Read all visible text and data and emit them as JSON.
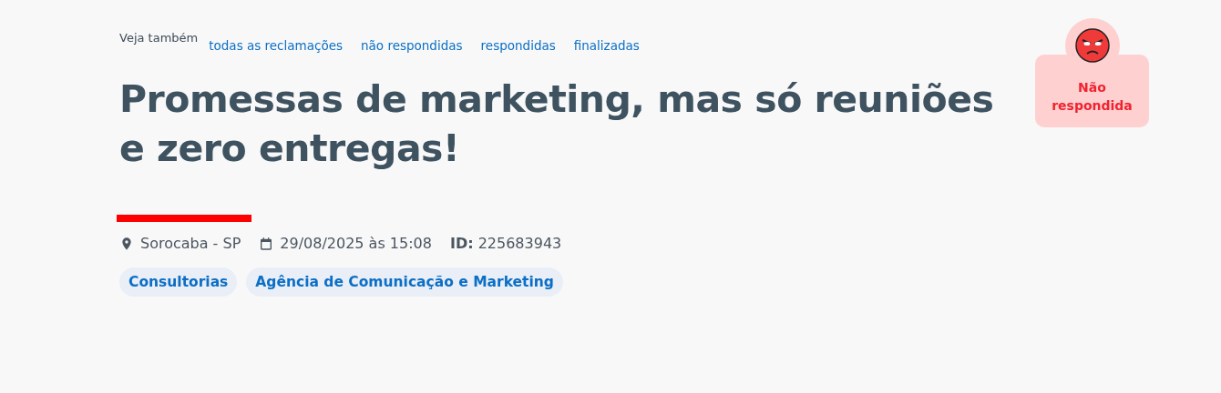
{
  "see_also": {
    "label": "Veja também",
    "links": [
      {
        "label": "todas as reclamações"
      },
      {
        "label": "não respondidas"
      },
      {
        "label": "respondidas"
      },
      {
        "label": "finalizadas"
      }
    ]
  },
  "title": "Promessas de marketing, mas só reuniões e zero entregas!",
  "company": {
    "redacted": true
  },
  "meta": {
    "location": "Sorocaba - SP",
    "date": "29/08/2025 às 15:08",
    "id_label": "ID:",
    "id_value": "225683943"
  },
  "tags": [
    {
      "label": "Consultorias"
    },
    {
      "label": "Agência de Comunicação e Marketing"
    }
  ],
  "status": {
    "kind": "not_answered",
    "label": "Não respondida"
  }
}
